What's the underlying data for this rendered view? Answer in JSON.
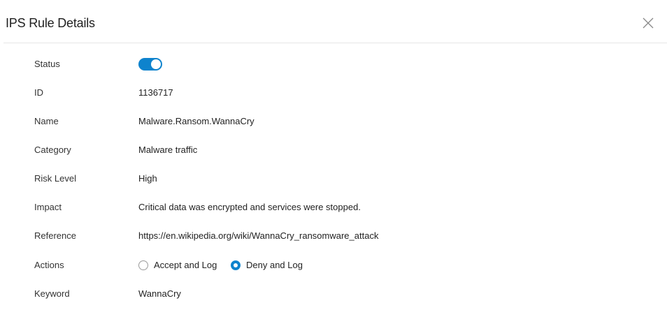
{
  "dialog": {
    "title": "IPS Rule Details",
    "close_icon": "close-icon"
  },
  "fields": {
    "status": {
      "label": "Status",
      "enabled": true
    },
    "id": {
      "label": "ID",
      "value": "1136717"
    },
    "name": {
      "label": "Name",
      "value": "Malware.Ransom.WannaCry"
    },
    "category": {
      "label": "Category",
      "value": "Malware traffic"
    },
    "risk_level": {
      "label": "Risk Level",
      "value": "High"
    },
    "impact": {
      "label": "Impact",
      "value": "Critical data was encrypted and services were stopped."
    },
    "reference": {
      "label": "Reference",
      "value": "https://en.wikipedia.org/wiki/WannaCry_ransomware_attack"
    },
    "actions": {
      "label": "Actions",
      "options": [
        {
          "label": "Accept and Log",
          "selected": false
        },
        {
          "label": "Deny and Log",
          "selected": true
        }
      ]
    },
    "keyword": {
      "label": "Keyword",
      "value": "WannaCry"
    }
  },
  "colors": {
    "accent": "#0e83cd",
    "divider": "#e6e6e6",
    "text": "#333333"
  }
}
